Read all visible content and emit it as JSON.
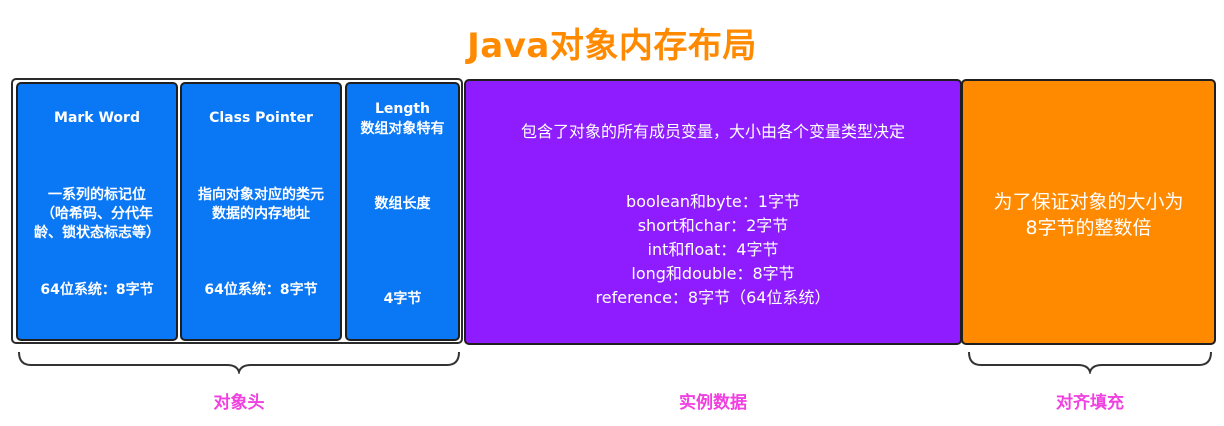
{
  "title": "Java对象内存布局",
  "header": {
    "mark_word": {
      "name": "Mark Word",
      "desc_lines": [
        "一系列的标记位",
        "（哈希码、分代年",
        "龄、锁状态标志等）"
      ],
      "size": "64位系统：8字节"
    },
    "class_pointer": {
      "name": "Class Pointer",
      "desc_lines": [
        "指向对象对应的类元",
        "数据的内存地址"
      ],
      "size": "64位系统：8字节"
    },
    "length": {
      "name": "Length",
      "note": "数组对象特有",
      "desc": "数组长度",
      "size": "4字节"
    }
  },
  "instance_data": {
    "intro": "包含了对象的所有成员变量，大小由各个变量类型决定",
    "items": [
      "boolean和byte：1字节",
      "short和char：2字节",
      "int和float：4字节",
      "long和double：8字节",
      "reference：8字节（64位系统）"
    ]
  },
  "padding": {
    "lines": [
      "为了保证对象的大小为",
      "8字节的整数倍"
    ]
  },
  "labels": {
    "object_header": "对象头",
    "instance_data": "实例数据",
    "padding": "对齐填充"
  },
  "colors": {
    "title": "#FF8A00",
    "header_blocks": "#0A77F5",
    "instance_data": "#8F1CFF",
    "padding": "#FF8A00",
    "labels": "#F040E0"
  }
}
